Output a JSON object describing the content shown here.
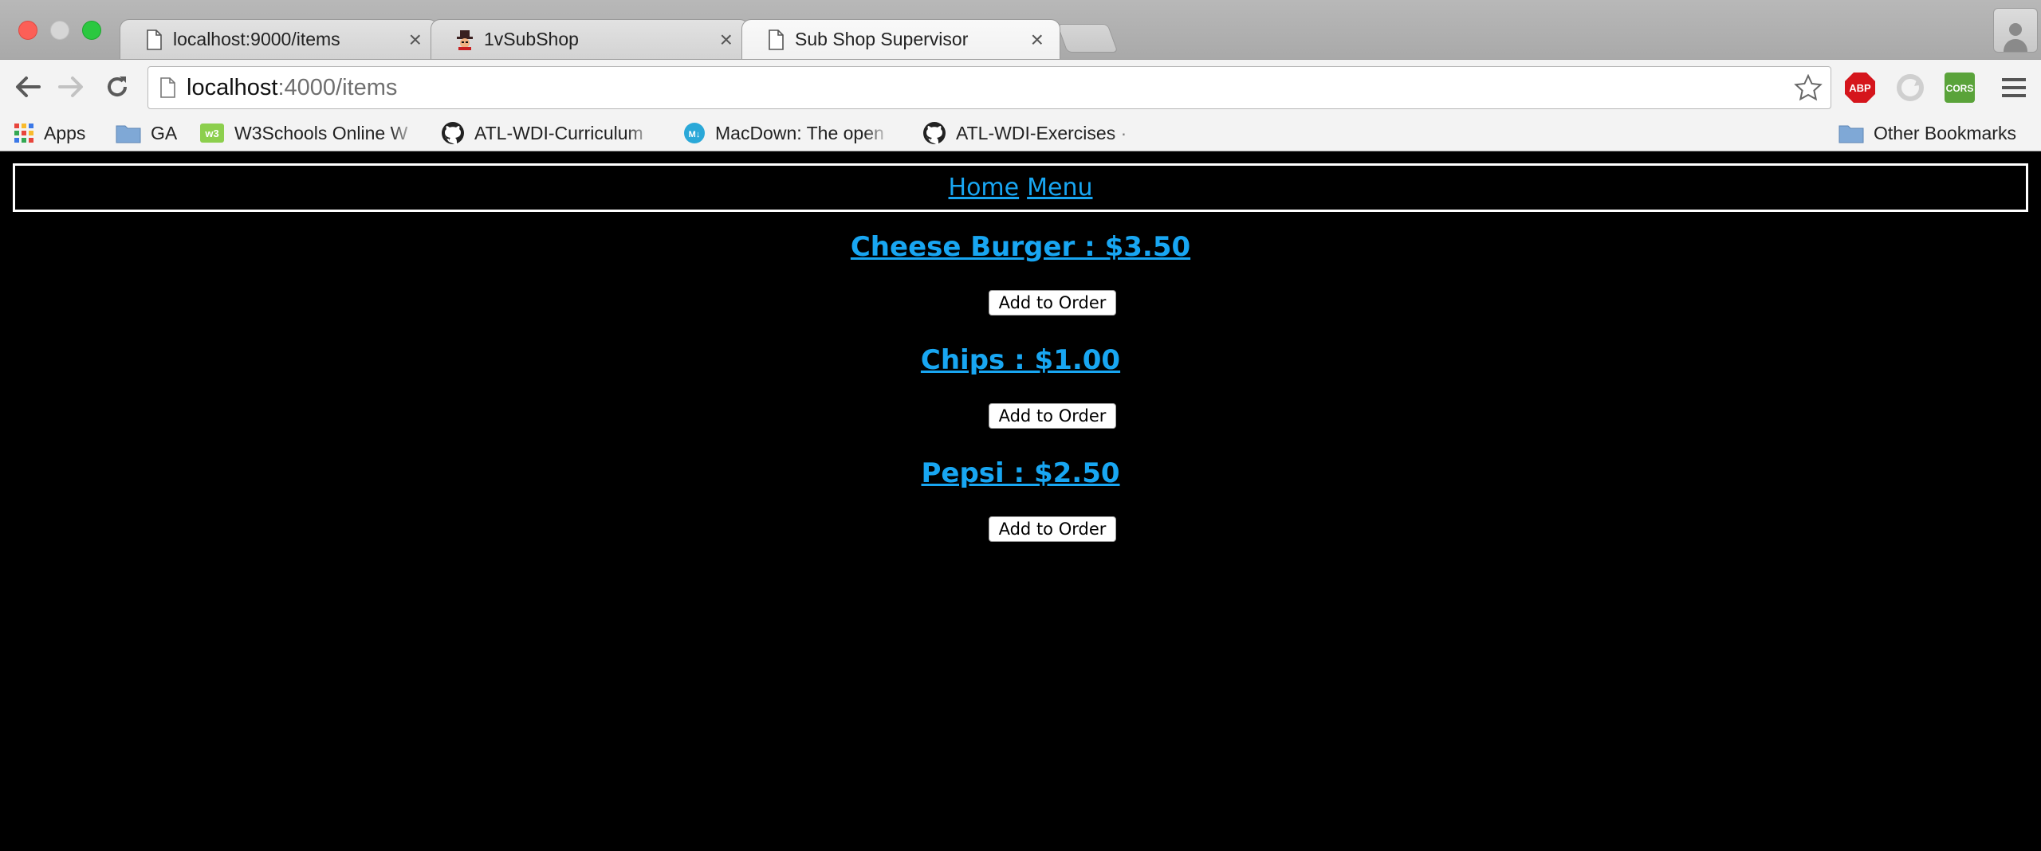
{
  "browser": {
    "tabs": [
      {
        "title": "localhost:9000/items",
        "favicon": "page-icon",
        "active": false
      },
      {
        "title": "1vSubShop",
        "favicon": "hat-character-icon",
        "active": false
      },
      {
        "title": "Sub Shop Supervisor",
        "favicon": "page-icon",
        "active": true
      }
    ],
    "tab_close_glyph": "×",
    "address_bar": {
      "host": "localhost",
      "rest": ":4000/items"
    },
    "extensions": [
      {
        "name": "adblock-plus-icon",
        "label": "ABP"
      },
      {
        "name": "sync-icon",
        "label": ""
      },
      {
        "name": "cors-icon",
        "label": "CORS"
      }
    ],
    "bookmarks": [
      {
        "label": "Apps",
        "icon": "apps-grid-icon"
      },
      {
        "label": "GA",
        "icon": "folder-icon"
      },
      {
        "label": "W3Schools Online W",
        "icon": "w3schools-icon"
      },
      {
        "label": "ATL-WDI-Curriculum",
        "icon": "github-icon"
      },
      {
        "label": "MacDown: The open",
        "icon": "macdown-icon"
      },
      {
        "label": "ATL-WDI-Exercises ·",
        "icon": "github-icon"
      },
      {
        "label": "Other Bookmarks",
        "icon": "folder-icon"
      }
    ]
  },
  "page": {
    "nav": {
      "home": "Home",
      "menu": "Menu"
    },
    "items": [
      {
        "title": "Cheese Burger : $3.50",
        "button": "Add to Order"
      },
      {
        "title": "Chips : $1.00",
        "button": "Add to Order"
      },
      {
        "title": "Pepsi : $2.50",
        "button": "Add to Order"
      }
    ]
  },
  "colors": {
    "link": "#18a6f2",
    "page_bg": "#000000",
    "nav_border": "#ffffff"
  }
}
